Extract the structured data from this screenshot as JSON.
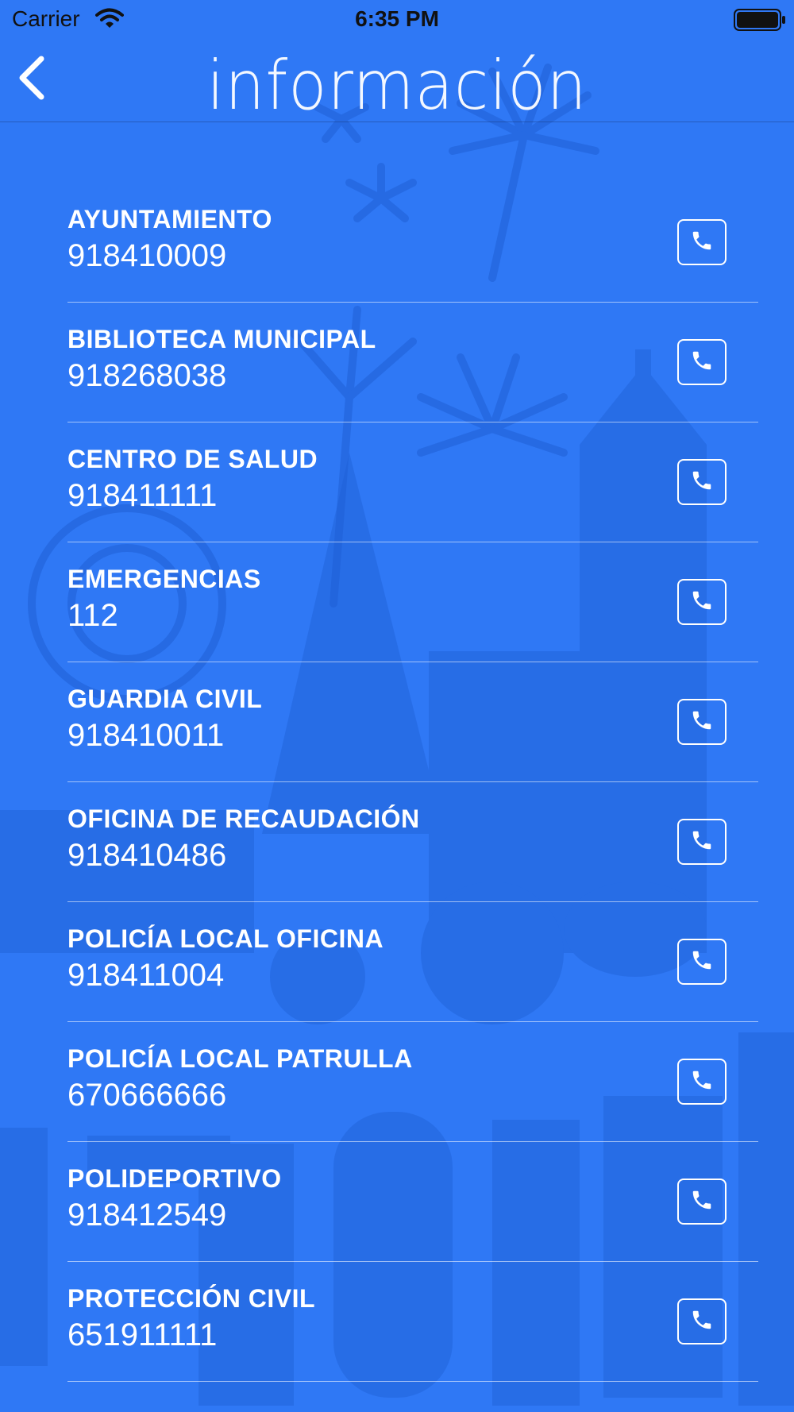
{
  "status_bar": {
    "carrier": "Carrier",
    "time": "6:35 PM",
    "wifi_icon": "wifi-icon",
    "battery_icon": "battery-icon"
  },
  "nav": {
    "title": "información",
    "back_icon": "chevron-left-icon"
  },
  "colors": {
    "background": "#2f78f5",
    "text": "#ffffff"
  },
  "contacts": [
    {
      "name": "AYUNTAMIENTO",
      "number": "918410009"
    },
    {
      "name": "BIBLIOTECA MUNICIPAL",
      "number": "918268038"
    },
    {
      "name": "CENTRO DE SALUD",
      "number": "918411111"
    },
    {
      "name": "EMERGENCIAS",
      "number": "112"
    },
    {
      "name": "GUARDIA CIVIL",
      "number": "918410011"
    },
    {
      "name": "OFICINA DE RECAUDACIÓN",
      "number": "918410486"
    },
    {
      "name": "POLICÍA LOCAL OFICINA",
      "number": "918411004"
    },
    {
      "name": "POLICÍA LOCAL PATRULLA",
      "number": "670666666"
    },
    {
      "name": "POLIDEPORTIVO",
      "number": "918412549"
    },
    {
      "name": "PROTECCIÓN CIVIL",
      "number": "651911111"
    }
  ],
  "call_icon": "phone-icon"
}
